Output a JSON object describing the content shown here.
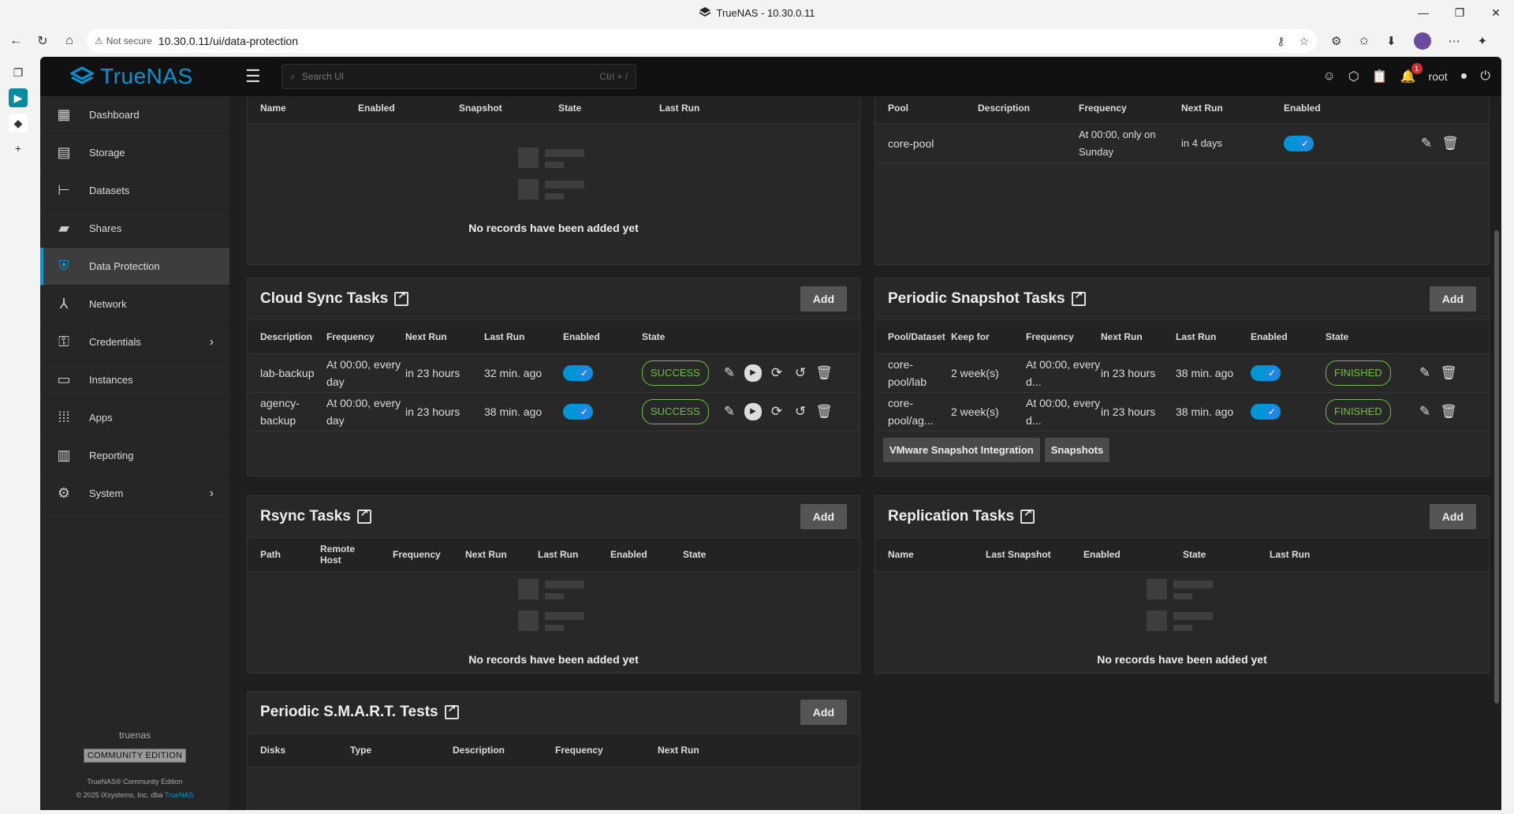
{
  "browser": {
    "window_title": "TrueNAS - 10.30.0.11",
    "not_secure": "Not secure",
    "url": "10.30.0.11/ui/data-protection"
  },
  "app": {
    "brand": "TrueNAS",
    "search_placeholder": "Search UI",
    "search_hint": "Ctrl + /",
    "notification_count": "1",
    "user": "root"
  },
  "sidebar": {
    "items": [
      {
        "label": "Dashboard",
        "icon": "dashboard-icon"
      },
      {
        "label": "Storage",
        "icon": "storage-icon"
      },
      {
        "label": "Datasets",
        "icon": "datasets-icon"
      },
      {
        "label": "Shares",
        "icon": "shares-icon"
      },
      {
        "label": "Data Protection",
        "icon": "shield-icon"
      },
      {
        "label": "Network",
        "icon": "network-icon"
      },
      {
        "label": "Credentials",
        "icon": "key-icon"
      },
      {
        "label": "Instances",
        "icon": "laptop-icon"
      },
      {
        "label": "Apps",
        "icon": "apps-grid-icon"
      },
      {
        "label": "Reporting",
        "icon": "chart-icon"
      },
      {
        "label": "System",
        "icon": "gear-icon"
      }
    ],
    "hostname": "truenas",
    "edition": "COMMUNITY EDITION",
    "copyright_line1": "TrueNAS® Community Edition",
    "copyright_line2": "© 2025 iXsystems, Inc. dba",
    "copyright_link": "TrueNAS"
  },
  "scrub_tasks": {
    "headers": [
      "Name",
      "Enabled",
      "Snapshot",
      "State",
      "Last Run"
    ],
    "empty": "No records have been added yet"
  },
  "scrub_right": {
    "headers": [
      "Pool",
      "Description",
      "Frequency",
      "Next Run",
      "Enabled"
    ],
    "rows": [
      {
        "pool": "core-pool",
        "description": "",
        "frequency": "At 00:00, only on Sunday",
        "next_run": "in 4 days",
        "enabled": true
      }
    ]
  },
  "cloud_sync": {
    "title": "Cloud Sync Tasks",
    "add": "Add",
    "headers": [
      "Description",
      "Frequency",
      "Next Run",
      "Last Run",
      "Enabled",
      "State"
    ],
    "rows": [
      {
        "description": "lab-backup",
        "frequency": "At 00:00, every day",
        "next_run": "in 23 hours",
        "last_run": "32 min. ago",
        "enabled": true,
        "state": "SUCCESS"
      },
      {
        "description": "agency-backup",
        "frequency": "At 00:00, every day",
        "next_run": "in 23 hours",
        "last_run": "38 min. ago",
        "enabled": true,
        "state": "SUCCESS"
      }
    ]
  },
  "periodic_snapshot": {
    "title": "Periodic Snapshot Tasks",
    "add": "Add",
    "headers": [
      "Pool/Dataset",
      "Keep for",
      "Frequency",
      "Next Run",
      "Last Run",
      "Enabled",
      "State"
    ],
    "rows": [
      {
        "pool": "core-pool/lab",
        "keep": "2 week(s)",
        "frequency": "At 00:00, every d...",
        "next_run": "in 23 hours",
        "last_run": "38 min. ago",
        "enabled": true,
        "state": "FINISHED"
      },
      {
        "pool": "core-pool/ag...",
        "keep": "2 week(s)",
        "frequency": "At 00:00, every d...",
        "next_run": "in 23 hours",
        "last_run": "38 min. ago",
        "enabled": true,
        "state": "FINISHED"
      }
    ],
    "vmware_btn": "VMware Snapshot Integration",
    "snapshots_btn": "Snapshots"
  },
  "rsync": {
    "title": "Rsync Tasks",
    "add": "Add",
    "headers": [
      "Path",
      "Remote Host",
      "Frequency",
      "Next Run",
      "Last Run",
      "Enabled",
      "State"
    ],
    "empty": "No records have been added yet"
  },
  "replication": {
    "title": "Replication Tasks",
    "add": "Add",
    "headers": [
      "Name",
      "Last Snapshot",
      "Enabled",
      "State",
      "Last Run"
    ],
    "empty": "No records have been added yet"
  },
  "smart": {
    "title": "Periodic S.M.A.R.T. Tests",
    "add": "Add",
    "headers": [
      "Disks",
      "Type",
      "Description",
      "Frequency",
      "Next Run"
    ]
  },
  "colors": {
    "accent": "#0095d5",
    "success": "#71bf44",
    "background": "#1f1f1f",
    "card": "#282828"
  }
}
